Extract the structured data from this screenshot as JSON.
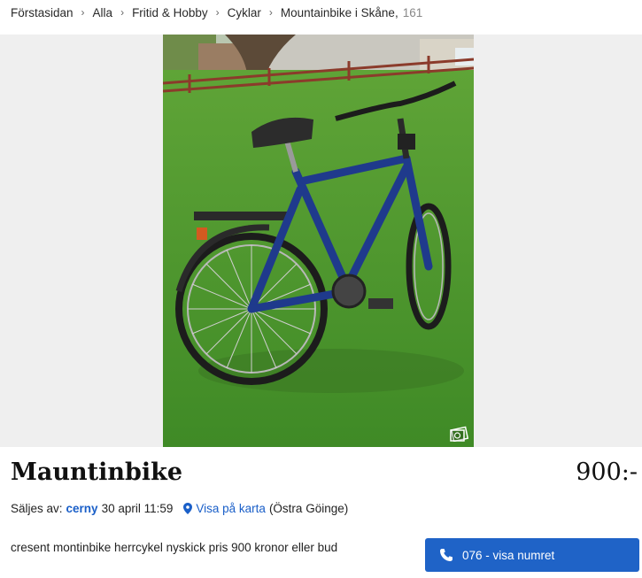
{
  "breadcrumb": {
    "items": [
      "Förstasidan",
      "Alla",
      "Fritid & Hobby",
      "Cyklar",
      "Mountainbike i Skåne,"
    ],
    "separator": "›",
    "count": "161"
  },
  "listing": {
    "title": "Mauntinbike",
    "price": "900:-",
    "seller_prefix": "Säljes av:",
    "seller_name": "cerny",
    "date": "30 april 11:59",
    "map_link": "Visa på karta",
    "location": "(Östra Göinge)",
    "description": "cresent montinbike herrcykel nyskick pris 900 kronor eller bud"
  },
  "contact": {
    "phone_button_label": "076 - visa numret"
  },
  "colors": {
    "link": "#1a5fc8",
    "button": "#1f63c7"
  },
  "icons": {
    "map": "map-pin-icon",
    "phone": "phone-icon",
    "gallery": "image-count-icon"
  }
}
